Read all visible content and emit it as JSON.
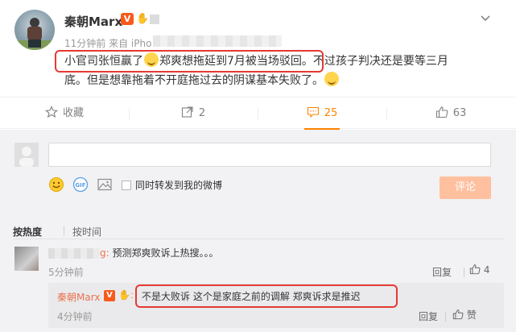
{
  "post": {
    "author": "秦朝Marx",
    "vip_badge": "V",
    "time_source": "11分钟前 来自 iPho",
    "content_line1_hl_a": "小官司张恒赢了",
    "content_line1_hl_b": "郑爽想拖延到7月被当场驳回。",
    "content_line1_rest": "不过孩子判决还是要等三月",
    "content_line2": "底。但是想靠拖着不开庭拖过去的阴谋基本失败了。"
  },
  "actions": {
    "favorite": "收藏",
    "repost_count": "2",
    "comment_count": "25",
    "like_count": "63"
  },
  "composer": {
    "repost_label": "同时转发到我的微博",
    "submit": "评论",
    "gif_label": "GIF"
  },
  "sort": {
    "hot": "按热度",
    "time": "按时间"
  },
  "comments": [
    {
      "name_suffix": "g:",
      "text": "预测郑爽败诉上热搜。。。",
      "time": "5分钟前",
      "reply_label": "回复",
      "likes": "4",
      "replies": [
        {
          "author": "秦朝Marx",
          "vip": "V",
          "text": "不是大败诉 这个是家庭之前的调解 郑爽诉求是推迟",
          "time": "4分钟前",
          "reply_label": "回复",
          "like_label": "赞"
        }
      ]
    }
  ],
  "colors": {
    "accent": "#ff8200",
    "highlight_border": "#e53935",
    "vip": "#f85a1b",
    "link_name": "#eb7350",
    "submit_disabled": "#ffc09f"
  }
}
